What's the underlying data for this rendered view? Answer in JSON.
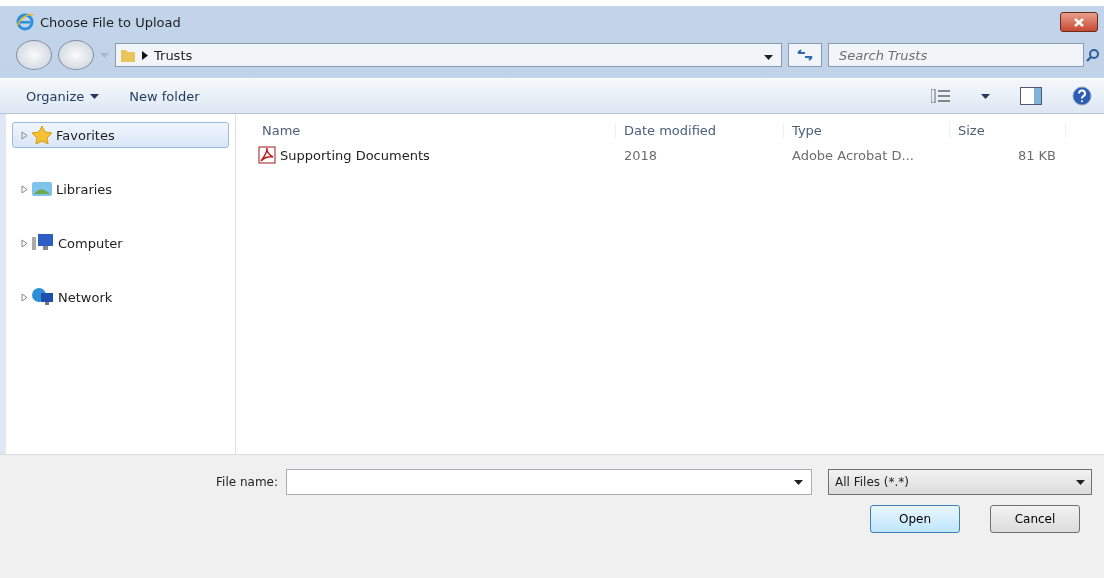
{
  "window": {
    "title": "Choose File to Upload"
  },
  "address": {
    "crumbs": [
      "Trusts"
    ]
  },
  "search": {
    "placeholder": "Search Trusts"
  },
  "toolbar": {
    "items": [
      "Organize",
      "New folder"
    ]
  },
  "sidebar": {
    "items": [
      {
        "label": "Favorites",
        "selected": true
      },
      {
        "label": "Libraries",
        "selected": false
      },
      {
        "label": "Computer",
        "selected": false
      },
      {
        "label": "Network",
        "selected": false
      }
    ]
  },
  "table": {
    "columns": [
      "Name",
      "Date modified",
      "Type",
      "Size"
    ],
    "rows": [
      {
        "name": "Supporting Documents",
        "date": "2018",
        "type": "Adobe Acrobat D...",
        "size": "81 KB"
      }
    ]
  },
  "footer": {
    "file_name_label": "File name:",
    "filter": "All Files (*.*)",
    "buttons": [
      "Open",
      "Cancel"
    ]
  }
}
